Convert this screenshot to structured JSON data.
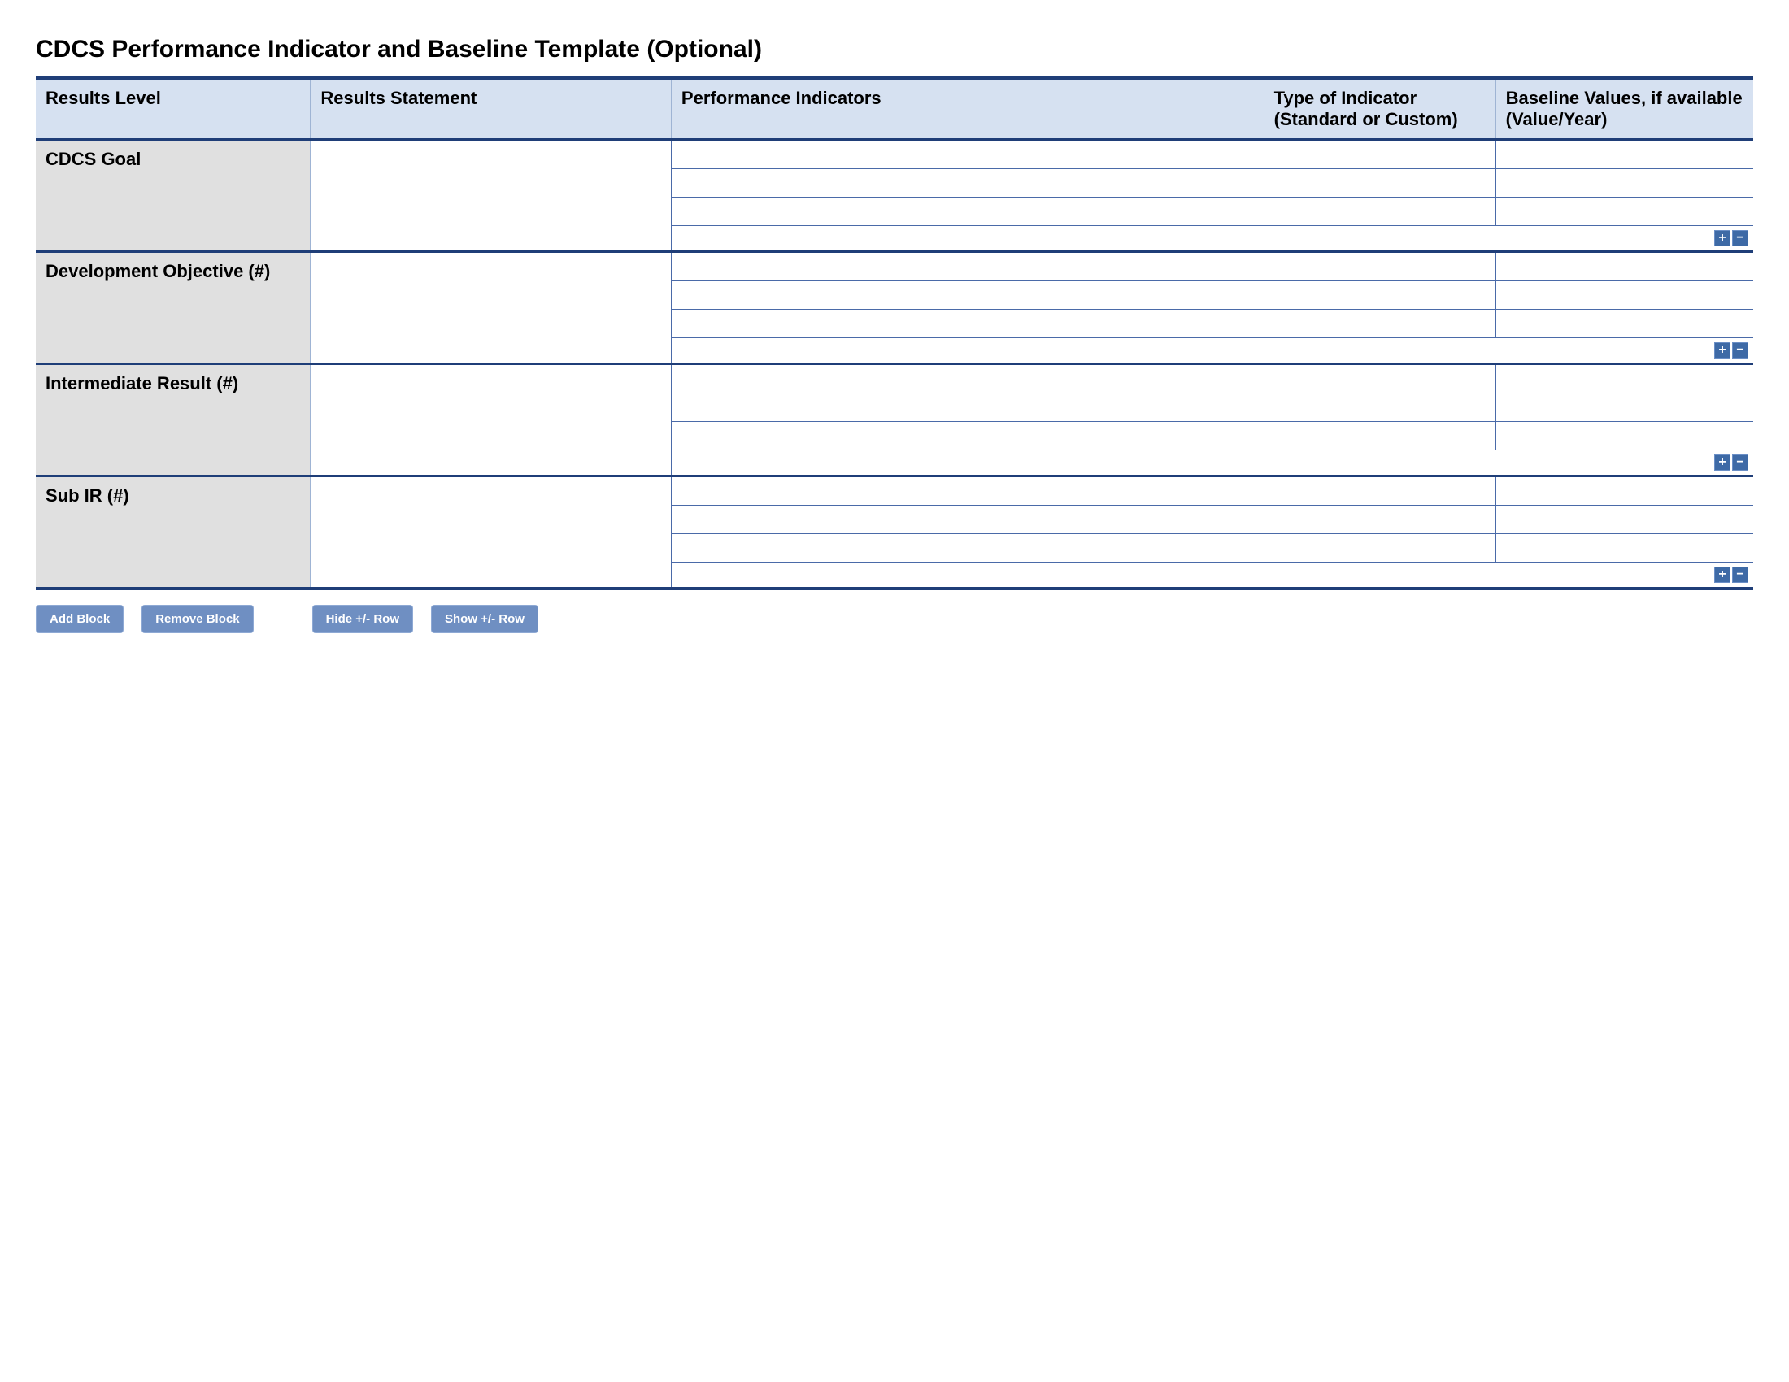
{
  "title": "CDCS Performance Indicator and Baseline Template (Optional)",
  "columns": {
    "level": "Results Level",
    "statement": "Results Statement",
    "indicators": "Performance Indicators",
    "type": "Type of Indicator (Standard or Custom)",
    "baseline": "Baseline Values, if available (Value/Year)"
  },
  "sections": [
    {
      "label": "CDCS Goal",
      "statement": "",
      "rows": [
        {
          "indicator": "",
          "type": "",
          "baseline": ""
        },
        {
          "indicator": "",
          "type": "",
          "baseline": ""
        },
        {
          "indicator": "",
          "type": "",
          "baseline": ""
        }
      ]
    },
    {
      "label": "Development Objective (#)",
      "statement": "",
      "rows": [
        {
          "indicator": "",
          "type": "",
          "baseline": ""
        },
        {
          "indicator": "",
          "type": "",
          "baseline": ""
        },
        {
          "indicator": "",
          "type": "",
          "baseline": ""
        }
      ]
    },
    {
      "label": "Intermediate Result (#)",
      "statement": "",
      "rows": [
        {
          "indicator": "",
          "type": "",
          "baseline": ""
        },
        {
          "indicator": "",
          "type": "",
          "baseline": ""
        },
        {
          "indicator": "",
          "type": "",
          "baseline": ""
        }
      ]
    },
    {
      "label": "Sub IR (#)",
      "statement": "",
      "rows": [
        {
          "indicator": "",
          "type": "",
          "baseline": ""
        },
        {
          "indicator": "",
          "type": "",
          "baseline": ""
        },
        {
          "indicator": "",
          "type": "",
          "baseline": ""
        }
      ]
    }
  ],
  "row_buttons": {
    "add": "+",
    "remove": "−"
  },
  "toolbar": {
    "add_block": "Add Block",
    "remove_block": "Remove Block",
    "hide_row": "Hide +/- Row",
    "show_row": "Show +/- Row"
  }
}
